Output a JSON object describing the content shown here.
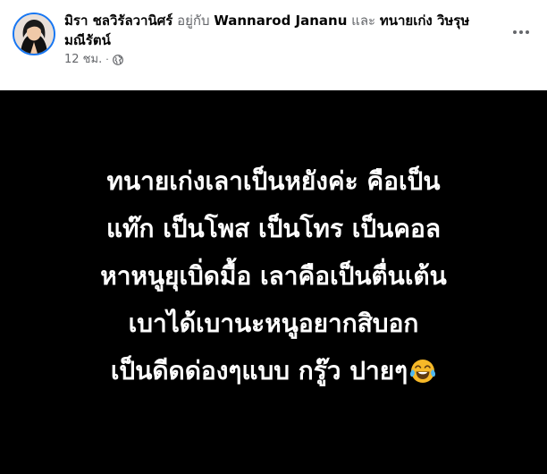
{
  "header": {
    "author": "มิรา ชลวิรัลวานิศร์",
    "with_text": " อยู่กับ ",
    "tag1": "Wannarod Jananu",
    "and_text": " และ ",
    "tag2": "ทนายเก่ง วิษรุษ มณีรัตน์",
    "time": "12 ชม.",
    "separator": "·",
    "privacy_icon": "globe-icon",
    "more_icon": "more-options-icon"
  },
  "post": {
    "background": "#000000",
    "text_color": "#ffffff",
    "lines": [
      "ทนายเก่งเลาเป็นหยังค่ะ คือเป็น",
      "แท๊ก เป็นโพส เป็นโทร เป็นคอล",
      "หาหนูยุเบิ่ดมื้อ เลาคือเป็นตื่นเต้น",
      "เบาได้เบานะหนูอยากสิบอก",
      "เป็นดีดด่องๆแบบ กรู๊ว ปายๆ"
    ],
    "emoji": "face-with-tears-of-joy-icon"
  },
  "colors": {
    "avatar_ring": "#1877f2",
    "secondary_text": "#65676b",
    "primary_text": "#050505"
  }
}
